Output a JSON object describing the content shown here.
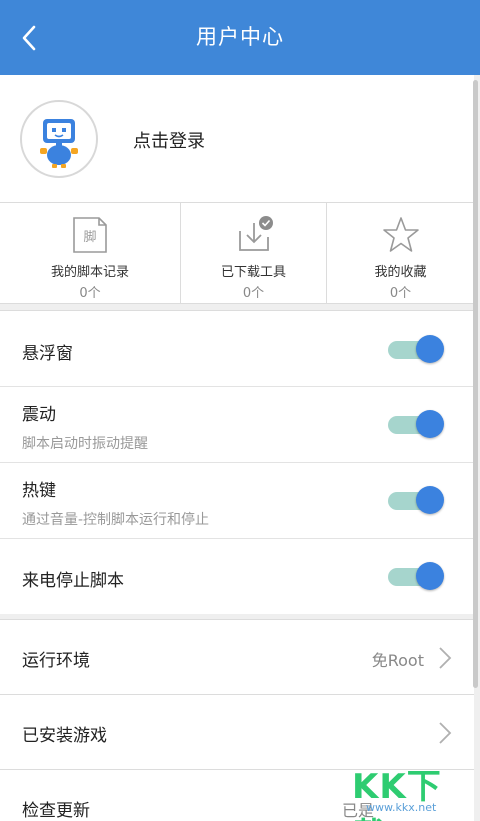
{
  "header": {
    "title": "用户中心",
    "back_icon": "chevron-left-icon"
  },
  "profile": {
    "login_text": "点击登录",
    "avatar_icon": "robot-avatar-icon"
  },
  "stats": [
    {
      "label": "我的脚本记录",
      "count": "0个",
      "icon": "script-file-icon",
      "icon_char": "脚"
    },
    {
      "label": "已下载工具",
      "count": "0个",
      "icon": "download-tray-icon"
    },
    {
      "label": "我的收藏",
      "count": "0个",
      "icon": "star-icon"
    }
  ],
  "settings": {
    "float_window": {
      "label": "悬浮窗",
      "enabled": true
    },
    "vibrate": {
      "label": "震动",
      "desc": "脚本启动时振动提醒",
      "enabled": true
    },
    "hotkey": {
      "label": "热键",
      "desc": "通过音量-控制脚本运行和停止",
      "enabled": true
    },
    "call_stop": {
      "label": "来电停止脚本",
      "enabled": true
    }
  },
  "nav": {
    "env": {
      "label": "运行环境",
      "value": "免Root"
    },
    "games": {
      "label": "已安装游戏"
    },
    "update": {
      "label": "检查更新",
      "value": "已是"
    }
  },
  "watermark": {
    "text": "KK下载",
    "url": "www.kkx.net"
  },
  "colors": {
    "accent": "#3f87d8",
    "toggle_track": "#a6d5cd",
    "toggle_knob": "#3b82df",
    "watermark": "#2ecc71"
  }
}
